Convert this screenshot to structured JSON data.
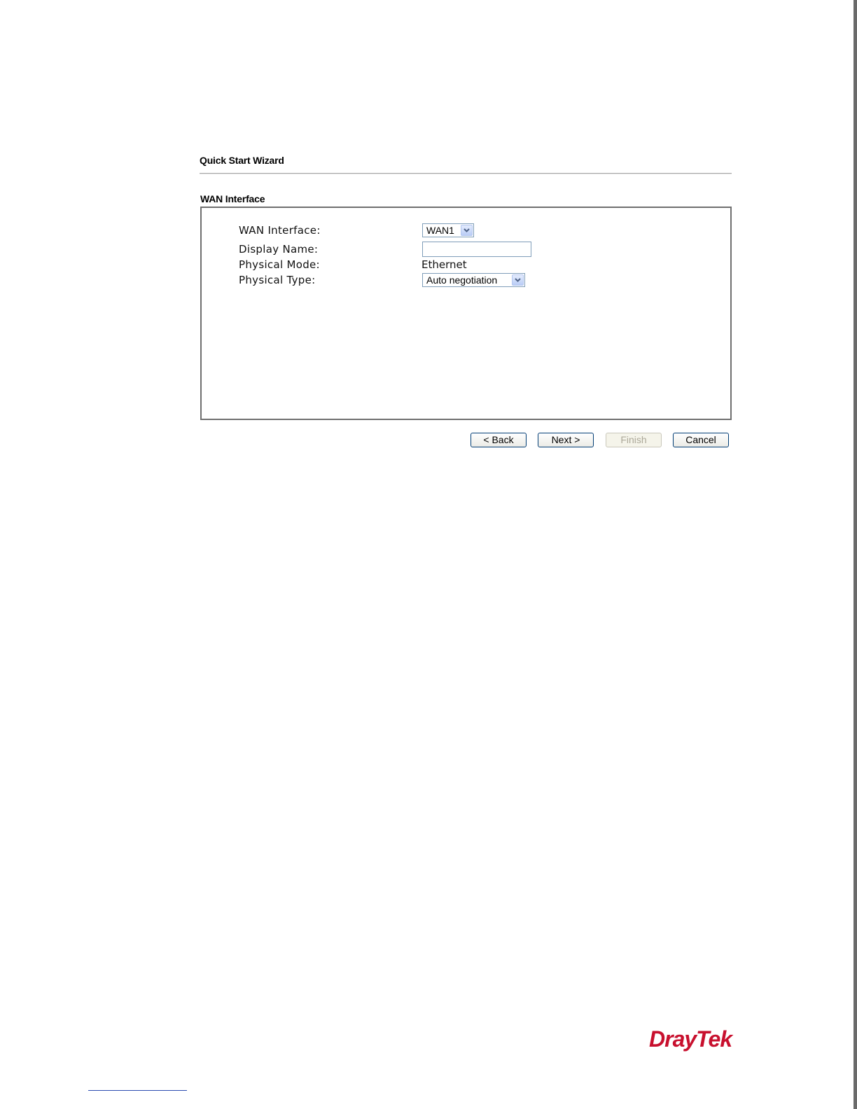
{
  "wizard": {
    "title": "Quick Start Wizard",
    "section_title": "WAN Interface"
  },
  "form": {
    "wan_interface": {
      "label": "WAN Interface:",
      "value": "WAN1"
    },
    "display_name": {
      "label": "Display Name:",
      "value": ""
    },
    "physical_mode": {
      "label": "Physical Mode:",
      "value": "Ethernet"
    },
    "physical_type": {
      "label": "Physical Type:",
      "value": "Auto negotiation"
    }
  },
  "buttons": {
    "back": "< Back",
    "next": "Next >",
    "finish": "Finish",
    "cancel": "Cancel"
  },
  "brand": {
    "logo_text": "DrayTek",
    "color": "#c8102e"
  },
  "icons": {
    "dropdown": "chevron-down-icon"
  }
}
